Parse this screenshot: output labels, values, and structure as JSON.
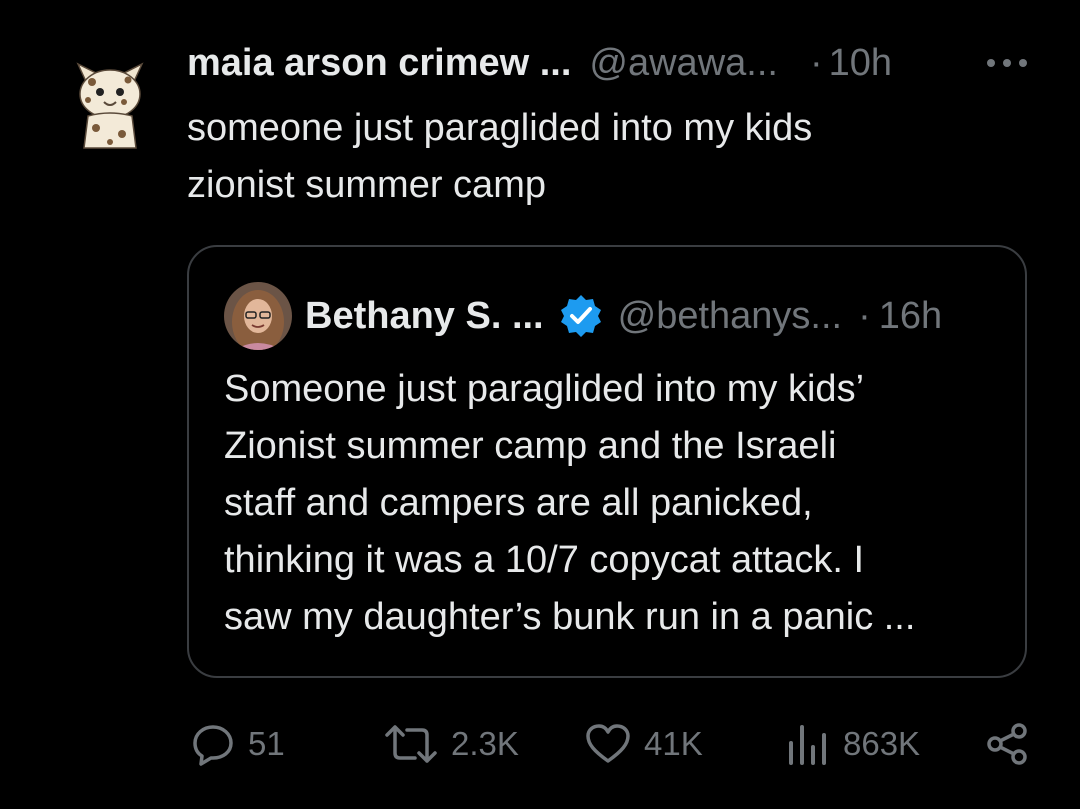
{
  "tweet": {
    "author_name": "maia arson crimew ...",
    "handle": "@awawa...",
    "separator": "·",
    "time": "10h",
    "more_icon": "more-horizontal-icon",
    "avatar_icon": "cat-avatar",
    "text_lines": [
      "someone just paraglided into my kids",
      "zionist summer camp"
    ]
  },
  "quote": {
    "author_name": "Bethany S. ...",
    "verified_icon": "verified-badge-icon",
    "verified_color": "#1d9bf0",
    "handle": "@bethanys...",
    "separator": "·",
    "time": "16h",
    "text_lines": [
      "Someone just paraglided into my kids’",
      "Zionist summer camp and the Israeli",
      "staff and campers are all panicked,",
      "thinking it was a 10/7 copycat attack. I",
      "saw my daughter’s bunk run in a panic ..."
    ]
  },
  "actions": {
    "replies": {
      "icon": "reply-icon",
      "count": "51"
    },
    "reposts": {
      "icon": "repost-icon",
      "count": "2.3K"
    },
    "likes": {
      "icon": "heart-icon",
      "count": "41K"
    },
    "views": {
      "icon": "views-icon",
      "count": "863K"
    },
    "share": {
      "icon": "share-icon"
    }
  },
  "colors": {
    "background": "#000000",
    "text_primary": "#e7e9ea",
    "text_secondary": "#71767b",
    "border": "#3a3d41"
  }
}
